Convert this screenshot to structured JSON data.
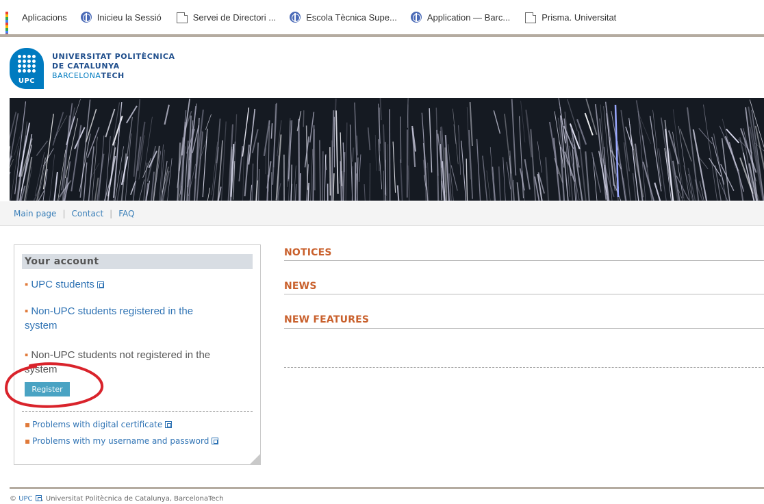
{
  "bookmarks": {
    "items": [
      {
        "label": "Aplicacions",
        "icon": "apps-icon"
      },
      {
        "label": "Inicieu la Sessió",
        "icon": "globe-icon"
      },
      {
        "label": "Servei de Directori ...",
        "icon": "page-icon"
      },
      {
        "label": "Escola Tècnica Supe...",
        "icon": "globe-icon"
      },
      {
        "label": "Application — Barc...",
        "icon": "globe-icon"
      },
      {
        "label": "Prisma. Universitat",
        "icon": "page-icon"
      }
    ]
  },
  "header": {
    "logo_mark": "UPC",
    "line1": "UNIVERSITAT POLITÈCNICA",
    "line2": "DE CATALUNYA",
    "line3_a": "BARCELONA",
    "line3_b": "TECH"
  },
  "nav": {
    "main_page": "Main page",
    "contact": "Contact",
    "faq": "FAQ",
    "sep": "|"
  },
  "sidebar": {
    "heading": "Your account",
    "upc_students": "UPC students",
    "non_upc_registered_1": "Non-UPC students registered in the",
    "non_upc_registered_2": "system",
    "non_upc_not_registered_1": "Non-UPC students not registered in the",
    "non_upc_not_registered_2": "system",
    "register_button": "Register",
    "problems_certificate": "Problems with digital certificate",
    "problems_username": "Problems with my username and password",
    "bullet": "▪"
  },
  "main": {
    "notices": "NOTICES",
    "news": "NEWS",
    "new_features": "NEW FEATURES"
  },
  "footer": {
    "copyright": "©",
    "upc_link": "UPC",
    "text": ", Universitat Politècnica de Catalunya, BarcelonaTech"
  },
  "colors": {
    "accent_orange": "#c9602c",
    "link_blue": "#2f73b4",
    "register_button": "#4aa3c3",
    "annotation_red": "#d9232b"
  }
}
